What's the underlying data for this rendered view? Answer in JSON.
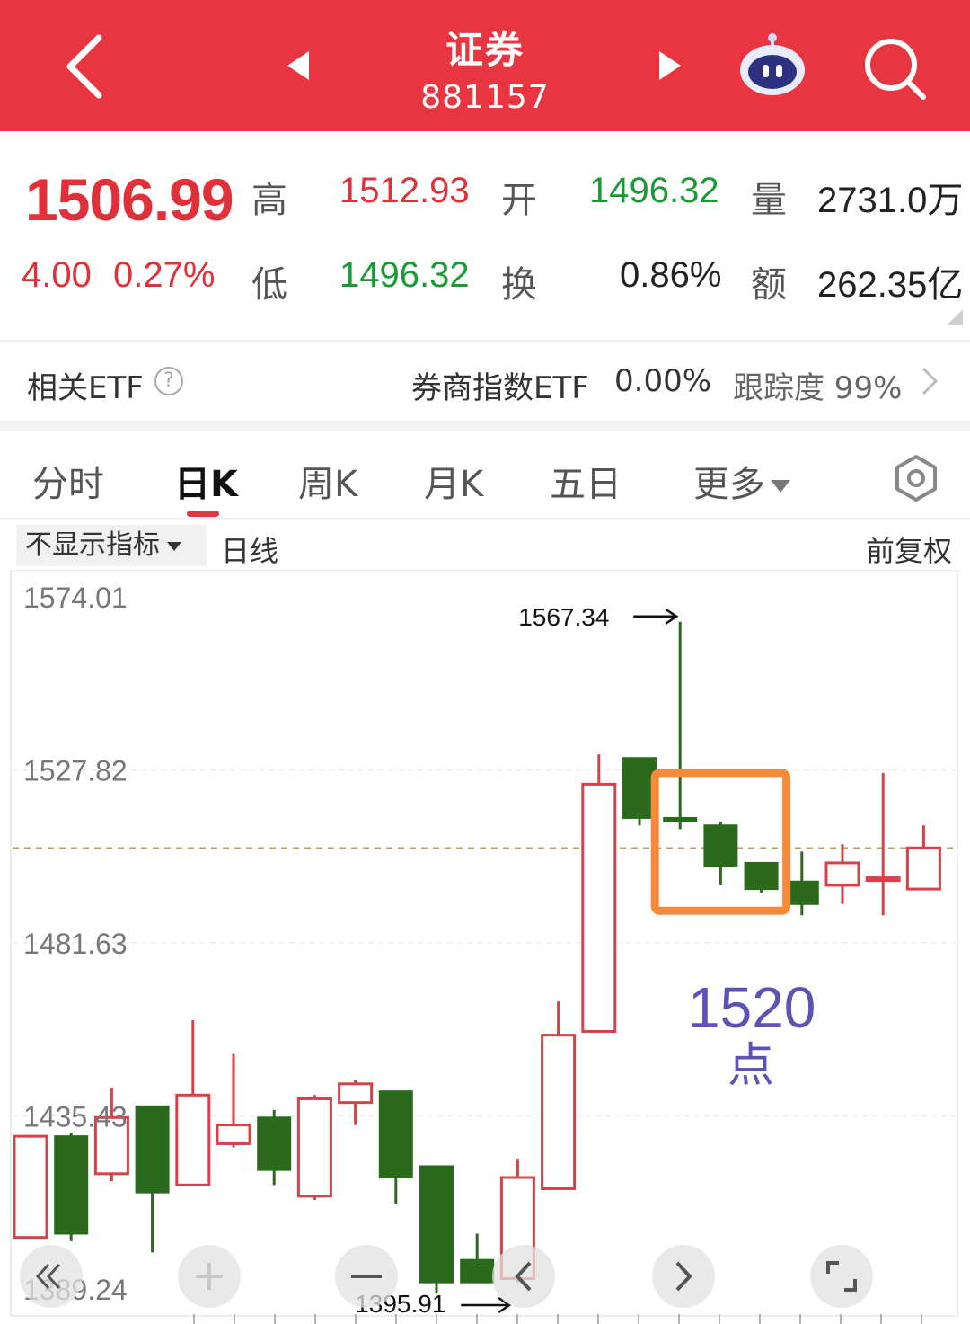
{
  "header": {
    "title": "证券",
    "code": "881157"
  },
  "quote": {
    "price": "1506.99",
    "change": "4.00",
    "change_pct": "0.27%",
    "high_label": "高",
    "high": "1512.93",
    "open_label": "开",
    "open": "1496.32",
    "volume_label": "量",
    "volume": "2731.0万",
    "low_label": "低",
    "low": "1496.32",
    "turnover_label": "换",
    "turnover": "0.86%",
    "amount_label": "额",
    "amount": "262.35亿"
  },
  "etf": {
    "label": "相关ETF",
    "help": "?",
    "name": "券商指数ETF",
    "pct": "0.00%",
    "tracking": "跟踪度 99%"
  },
  "tabs": {
    "items": [
      "分时",
      "日K",
      "周K",
      "月K",
      "五日",
      "更多"
    ],
    "active": "日K"
  },
  "indicator": {
    "select": "不显示指标",
    "period": "日线",
    "adjust": "前复权"
  },
  "colors": {
    "header": "#e8353f",
    "up": "#d9414a",
    "down": "#2b6a1c",
    "highlight": "#f58b3a",
    "annotation": "#5b53b5"
  },
  "chart_data": {
    "type": "candlestick",
    "y_labels": [
      "1574.01",
      "1527.82",
      "1481.63",
      "1435.43",
      "1389.24"
    ],
    "ylim": [
      1389.24,
      1574.01
    ],
    "max_marker": "1567.34",
    "min_marker": "1395.91",
    "reference_line": 1506.99,
    "annotation_value": "1520",
    "annotation_unit": "点",
    "candles": [
      {
        "o": 1403,
        "h": 1430,
        "l": 1403,
        "c": 1430,
        "dir": "up"
      },
      {
        "o": 1430,
        "h": 1431,
        "l": 1402,
        "c": 1404,
        "dir": "down"
      },
      {
        "o": 1420,
        "h": 1443,
        "l": 1418,
        "c": 1435,
        "dir": "up"
      },
      {
        "o": 1438,
        "h": 1438,
        "l": 1399,
        "c": 1415,
        "dir": "down"
      },
      {
        "o": 1417,
        "h": 1461,
        "l": 1417,
        "c": 1441,
        "dir": "up"
      },
      {
        "o": 1428,
        "h": 1452,
        "l": 1427,
        "c": 1433,
        "dir": "up"
      },
      {
        "o": 1435,
        "h": 1437,
        "l": 1417,
        "c": 1421,
        "dir": "down"
      },
      {
        "o": 1414,
        "h": 1441,
        "l": 1413,
        "c": 1440,
        "dir": "up"
      },
      {
        "o": 1439,
        "h": 1445,
        "l": 1433,
        "c": 1444,
        "dir": "up"
      },
      {
        "o": 1442,
        "h": 1442,
        "l": 1412,
        "c": 1419,
        "dir": "down"
      },
      {
        "o": 1422,
        "h": 1422,
        "l": 1388,
        "c": 1391,
        "dir": "down"
      },
      {
        "o": 1397,
        "h": 1404,
        "l": 1391,
        "c": 1391,
        "dir": "down"
      },
      {
        "o": 1392,
        "h": 1424,
        "l": 1391,
        "c": 1419,
        "dir": "up"
      },
      {
        "o": 1416,
        "h": 1466,
        "l": 1416,
        "c": 1457,
        "dir": "up"
      },
      {
        "o": 1458,
        "h": 1532,
        "l": 1458,
        "c": 1524,
        "dir": "up"
      },
      {
        "o": 1531,
        "h": 1531,
        "l": 1513,
        "c": 1515,
        "dir": "down"
      },
      {
        "o": 1515,
        "h": 1567.34,
        "l": 1512,
        "c": 1514,
        "dir": "down"
      },
      {
        "o": 1513,
        "h": 1514,
        "l": 1497,
        "c": 1502,
        "dir": "down"
      },
      {
        "o": 1503,
        "h": 1503,
        "l": 1495,
        "c": 1496,
        "dir": "down"
      },
      {
        "o": 1498,
        "h": 1506,
        "l": 1489,
        "c": 1492,
        "dir": "down"
      },
      {
        "o": 1497,
        "h": 1508,
        "l": 1492,
        "c": 1503,
        "dir": "up"
      },
      {
        "o": 1499,
        "h": 1527,
        "l": 1489,
        "c": 1499,
        "dir": "up"
      },
      {
        "o": 1496,
        "h": 1513,
        "l": 1496,
        "c": 1507,
        "dir": "up"
      }
    ],
    "highlight_range": [
      16,
      18
    ]
  }
}
